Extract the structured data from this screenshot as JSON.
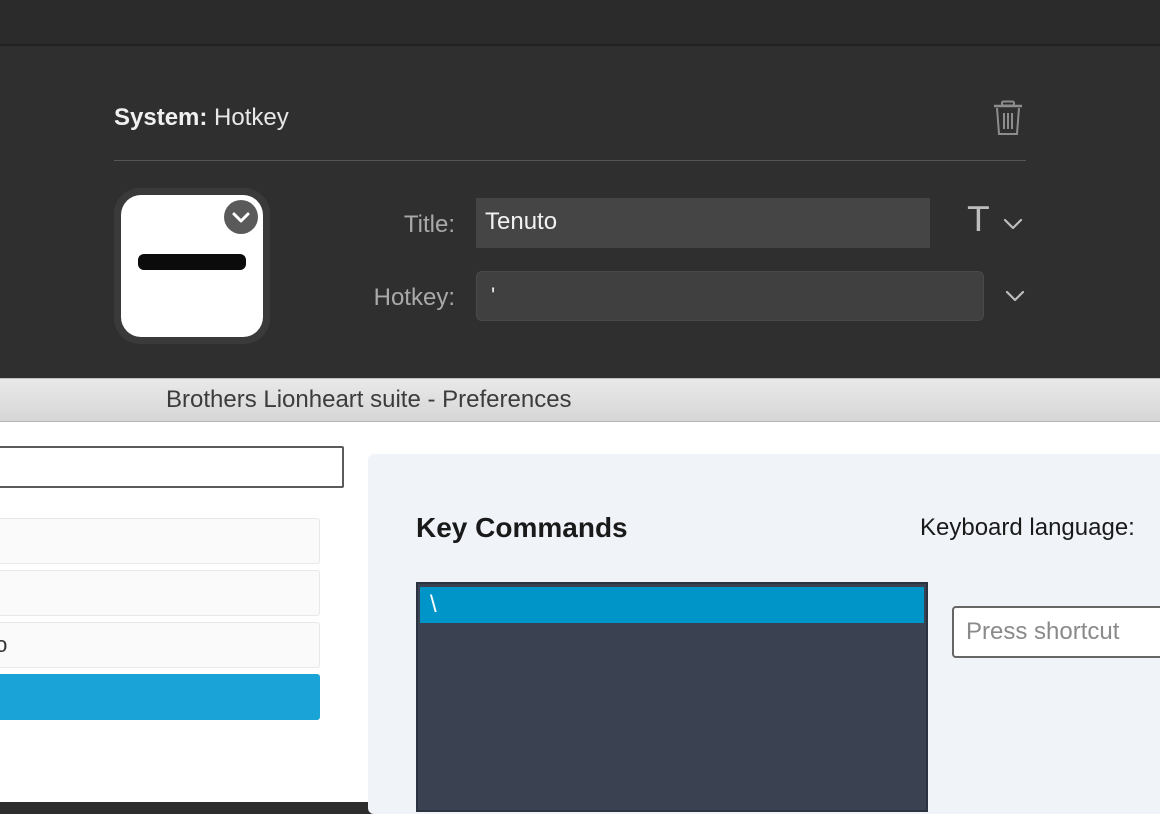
{
  "top_panel": {
    "system_label": "System:",
    "action_name": "Hotkey",
    "title_label": "Title:",
    "title_value": "Tenuto",
    "hotkey_label": "Hotkey:",
    "hotkey_value": "'",
    "text_format_glyph": "T",
    "icons": {
      "delete": "trash-icon",
      "badge": "chevron-down-icon",
      "title_menu": "chevron-down-icon",
      "hotkey_menu": "chevron-down-icon"
    }
  },
  "preferences": {
    "window_title": "Brothers Lionheart suite - Preferences",
    "list_items": [
      "",
      "",
      "to",
      ""
    ],
    "key_commands_heading": "Key Commands",
    "keyboard_language_label": "Keyboard language:",
    "selected_command": "\\",
    "shortcut_placeholder": "Press shortcut",
    "colors": {
      "selected_item": "#1aa3d6",
      "list_selection": "#0095c9",
      "list_background": "#3a4251"
    }
  }
}
